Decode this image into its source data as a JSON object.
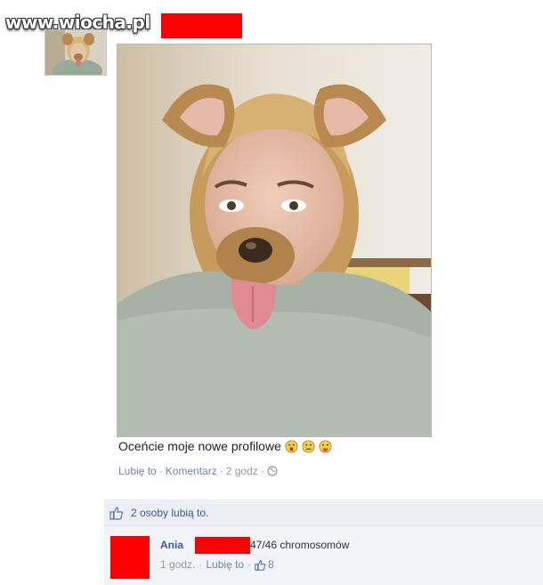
{
  "watermark": "www.wiocha.pl",
  "post": {
    "caption": "Oceńcie moje nowe profilowe",
    "caption_emojis": [
      "surprised-face-icon",
      "neutral-face-icon",
      "tongue-face-icon"
    ],
    "actions": {
      "like": "Lubię to",
      "comment": "Komentarz",
      "time": "2 godz"
    }
  },
  "likes_summary": "2 osoby lubią to.",
  "comment": {
    "author": "Ania",
    "text": "47/46 chromosomów",
    "time": "1 godz.",
    "like": "Lubię to",
    "like_count": "8"
  },
  "colors": {
    "link": "#6d84b4",
    "name": "#3b5998",
    "redaction": "#ff0000",
    "likes_bg": "#eceff5",
    "comment_bg": "#f2f3f7"
  }
}
